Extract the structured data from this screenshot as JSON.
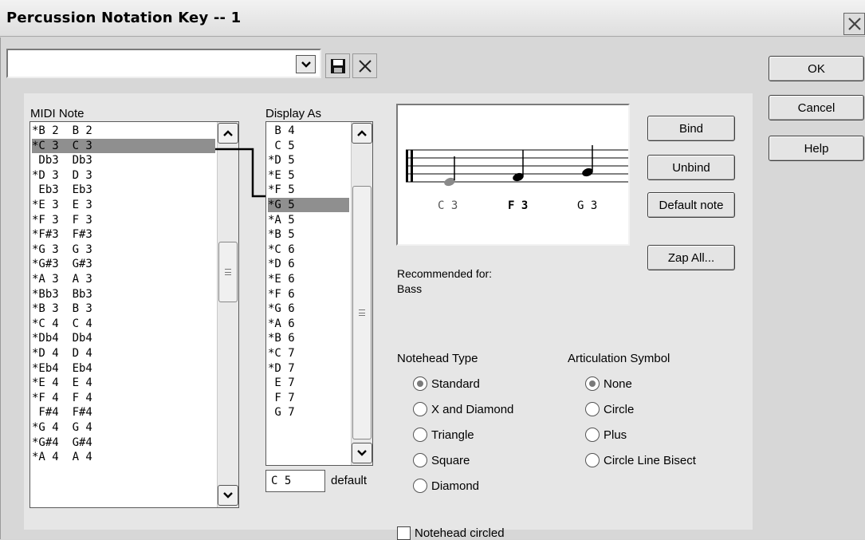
{
  "window": {
    "title": "Percussion Notation Key -- 1"
  },
  "buttons": {
    "ok": "OK",
    "cancel": "Cancel",
    "help": "Help",
    "bind": "Bind",
    "unbind": "Unbind",
    "default_note": "Default note",
    "zap_all": "Zap All..."
  },
  "midi_list": {
    "header": "MIDI Note",
    "selected_index": 1,
    "items": [
      "*B 2  B 2",
      "*C 3  C 3",
      " Db3  Db3",
      "*D 3  D 3",
      " Eb3  Eb3",
      "*E 3  E 3",
      "*F 3  F 3",
      "*F#3  F#3",
      "*G 3  G 3",
      "*G#3  G#3",
      "*A 3  A 3",
      "*Bb3  Bb3",
      "*B 3  B 3",
      "*C 4  C 4",
      "*Db4  Db4",
      "*D 4  D 4",
      "*Eb4  Eb4",
      "*E 4  E 4",
      "*F 4  F 4",
      " F#4  F#4",
      "*G 4  G 4",
      "*G#4  G#4",
      "*A 4  A 4"
    ]
  },
  "display_list": {
    "header": "Display As",
    "selected_index": 5,
    "items": [
      " B 4",
      " C 5",
      "*D 5",
      "*E 5",
      "*F 5",
      "*G 5",
      "*A 5",
      "*B 5",
      "*C 6",
      "*D 6",
      "*E 6",
      "*F 6",
      "*G 6",
      "*A 6",
      "*B 6",
      "*C 7",
      "*D 7",
      " E 7",
      " F 7",
      " G 7"
    ],
    "default_value": "C 5",
    "default_label": "default"
  },
  "staff": {
    "captions": [
      "C 3",
      "F 3",
      "G 3"
    ]
  },
  "recommended": {
    "label": "Recommended for:",
    "value": "Bass"
  },
  "notehead": {
    "heading": "Notehead Type",
    "selected": "Standard",
    "options": [
      "Standard",
      "X and Diamond",
      "Triangle",
      "Square",
      "Diamond"
    ],
    "circled_label": "Notehead circled",
    "circled": false
  },
  "articulation": {
    "heading": "Articulation Symbol",
    "selected": "None",
    "options": [
      "None",
      "Circle",
      "Plus",
      "Circle Line Bisect"
    ]
  },
  "icons": [
    "chevron-down-icon",
    "save-icon",
    "delete-icon",
    "close-icon",
    "chevron-up-icon",
    "scroll-grip-icon"
  ],
  "colors": {
    "selection": "#8f8f8f",
    "window": "#d7d7d7",
    "panel": "#e6e6e6"
  }
}
